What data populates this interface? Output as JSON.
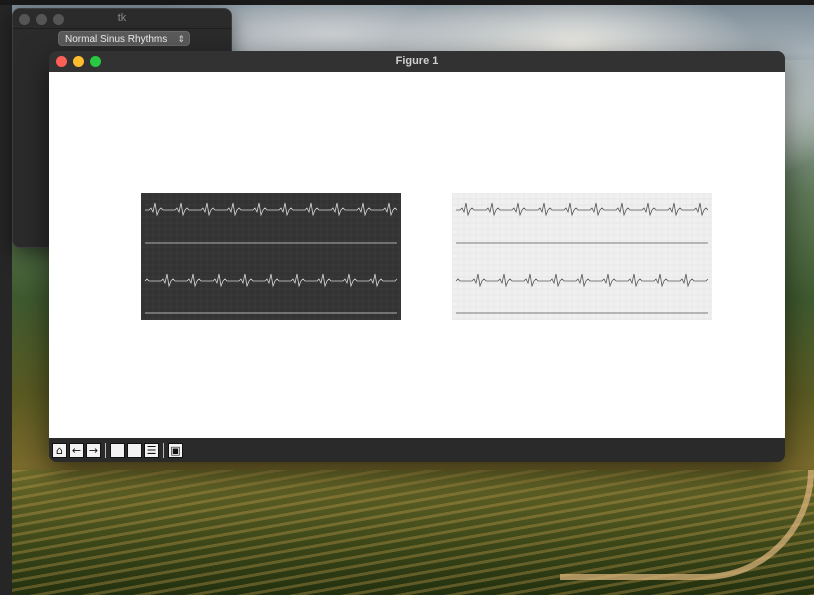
{
  "tk_window": {
    "title": "tk",
    "dropdown": {
      "selected": "Normal Sinus Rhythms"
    }
  },
  "figure_window": {
    "title": "Figure 1",
    "images": [
      {
        "name": "ecg-dark",
        "theme": "dark",
        "background": "#333333",
        "trace_color": "#d8d8d8"
      },
      {
        "name": "ecg-light",
        "theme": "light",
        "background": "#f0f0f0",
        "trace_color": "#555555"
      }
    ],
    "toolbar": [
      {
        "name": "home-button",
        "icon": "home-icon",
        "glyph": "⌂"
      },
      {
        "name": "back-button",
        "icon": "back-arrow-icon",
        "glyph": "←"
      },
      {
        "name": "forward-button",
        "icon": "forward-arrow-icon",
        "glyph": "→"
      },
      {
        "name": "pan-button",
        "icon": "pan-icon",
        "glyph": ""
      },
      {
        "name": "zoom-button",
        "icon": "zoom-icon",
        "glyph": ""
      },
      {
        "name": "configure-subplots-button",
        "icon": "sliders-icon",
        "glyph": "☰"
      },
      {
        "name": "save-button",
        "icon": "save-icon",
        "glyph": "▣"
      }
    ]
  },
  "colors": {
    "close": "#fe5f57",
    "minimize": "#febc2e",
    "zoom": "#28c840"
  }
}
